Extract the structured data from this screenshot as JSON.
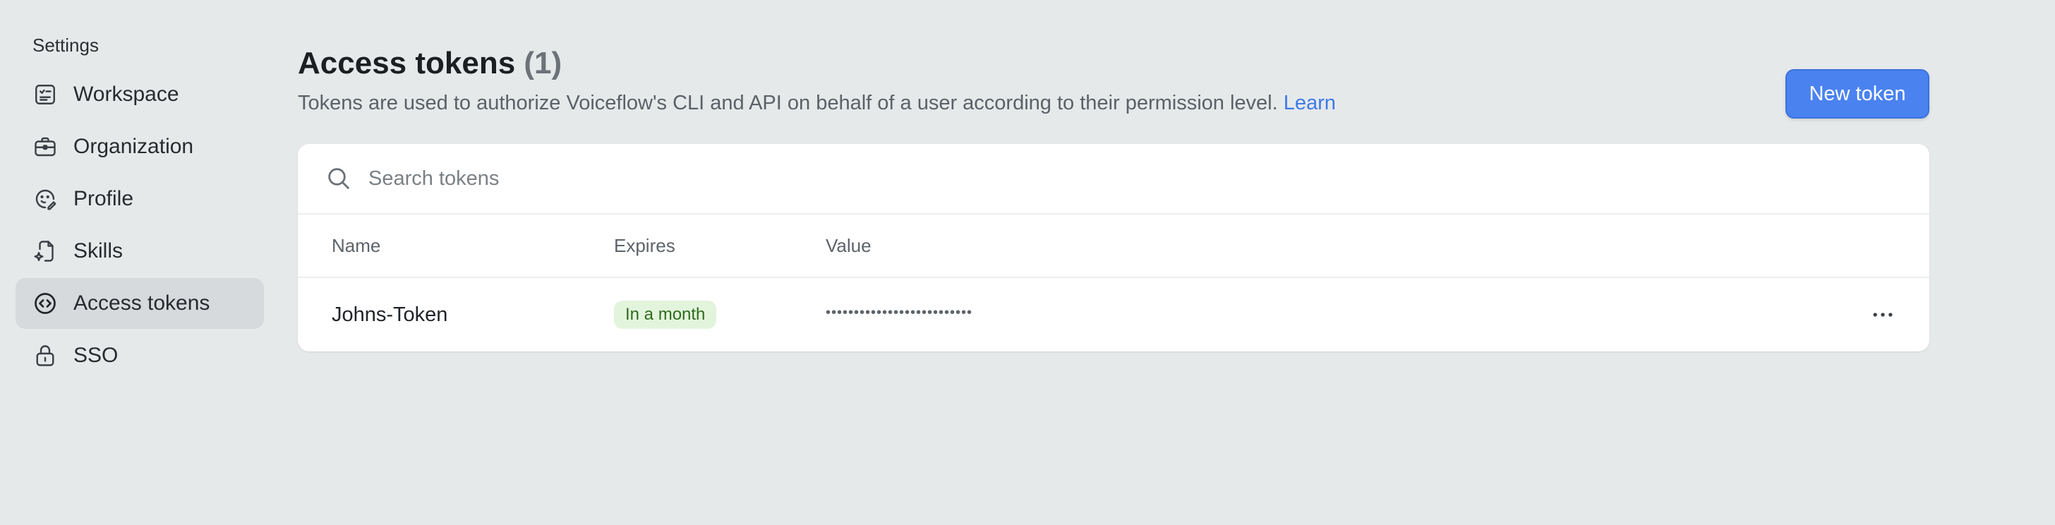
{
  "sidebar": {
    "title": "Settings",
    "items": [
      {
        "label": "Workspace",
        "icon": "workspace-icon"
      },
      {
        "label": "Organization",
        "icon": "briefcase-icon"
      },
      {
        "label": "Profile",
        "icon": "profile-face-icon"
      },
      {
        "label": "Skills",
        "icon": "skills-icon"
      },
      {
        "label": "Access tokens",
        "icon": "code-brackets-icon",
        "active": true
      },
      {
        "label": "SSO",
        "icon": "lock-icon"
      }
    ]
  },
  "header": {
    "title": "Access tokens",
    "count": "(1)",
    "subtitle": "Tokens are used to authorize Voiceflow's CLI and API on behalf of a user according to their permission level.",
    "learn_link": "Learn",
    "new_token_label": "New token"
  },
  "search": {
    "placeholder": "Search tokens",
    "value": ""
  },
  "table": {
    "columns": [
      "Name",
      "Expires",
      "Value"
    ],
    "rows": [
      {
        "name": "Johns-Token",
        "expires": "In a month",
        "value": "••••••••••••••••••••••••••"
      }
    ]
  },
  "colors": {
    "accent": "#4a82f0",
    "link": "#3e7be8",
    "badge_bg": "#e3f4dc",
    "badge_text": "#2f6b1f",
    "background": "#e6e9ea"
  }
}
